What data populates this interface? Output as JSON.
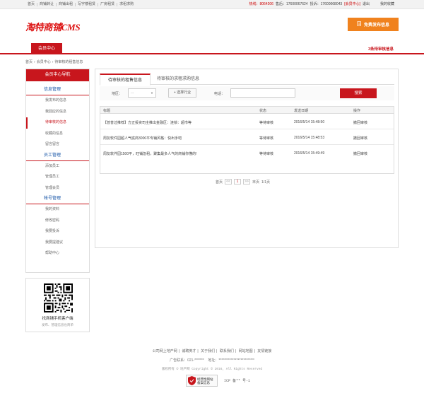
{
  "topbar": {
    "links": [
      "首页",
      "商铺转让",
      "商铺出租",
      "写字楼租赁",
      "厂房租赁",
      "求租求购"
    ],
    "hotline_label": "热线：",
    "hotline": "8064206",
    "phone_label": "售后：",
    "phone": "17600067624",
    "complaint_label": "投诉：",
    "complaint": "17600068043",
    "member_center": "[会员中心]",
    "logout": "退出",
    "my_favorites": "我的收藏"
  },
  "header": {
    "logo": "淘特商铺CMS",
    "publish_button": "免费发布信息"
  },
  "nav": {
    "tab": "会员中心",
    "right_notice": "3条待审核信息"
  },
  "breadcrumb": [
    "首页",
    "会员中心",
    "待审核的租售信息"
  ],
  "sidebar": {
    "title": "会员中心导航",
    "groups": [
      {
        "title": "信息管理",
        "items": [
          "我发布的信息",
          "我回应的信息",
          "待审核的信息",
          "收藏的信息",
          "留言留言"
        ]
      },
      {
        "title": "员工管理",
        "items": [
          "添加员工",
          "管理员工",
          "管理会员"
        ]
      },
      {
        "title": "帐号管理",
        "items": [
          "我的资料",
          "修改密码",
          "我要投诉",
          "我要提建议",
          "帮助中心"
        ]
      }
    ],
    "active_item": "待审核的信息"
  },
  "qr": {
    "title": "找商铺手机客户端",
    "subtitle": "发布、管理信息也简单"
  },
  "main": {
    "tabs": [
      "待审核的租售信息",
      "待审核的求租求购信息"
    ],
    "filter": {
      "area_label": "地区：",
      "area_value": "...",
      "industry_button": "+ 选择行业",
      "phone_label": "电话：",
      "phone_value": "",
      "search_button": "搜索"
    },
    "table": {
      "headers": [
        "标题",
        "状态",
        "发送日期",
        "操作"
      ],
      "rows": [
        {
          "title": "【普普过推荐】方正投资司主推出金融区：连锁：超市等",
          "status": "等待审核",
          "date": "2016/5/14 15:48:50",
          "action": "撤回审核"
        },
        {
          "title": "周友软件园超人气底商3000平专铺风格：快出手吧",
          "status": "等待审核",
          "date": "2016/5/14 15:48:53",
          "action": "撤回审核"
        },
        {
          "title": "周友软件园1500平，旺铺急租，聚集最多人气的商铺你懂的!",
          "status": "等待审核",
          "date": "2016/5/14 15:49:49",
          "action": "撤回审核"
        }
      ]
    },
    "pager": {
      "first": "首页",
      "prev": "<<",
      "current": "1",
      "next": ">>",
      "last": "末页",
      "count": "1/1页"
    }
  },
  "footer": {
    "links": [
      "公司网上地产网",
      "诚聘英才",
      "关于我们",
      "联系我们",
      "网站地图",
      "友情链接"
    ],
    "contact_label": "广告联系：",
    "contact": "021-*******",
    "address_label": "地址：",
    "address": "**************************",
    "copyright": "版权所有 © 地产网 Copyright © 2016, All Rights Reserved",
    "badge_line1": "经营性网站",
    "badge_line2": "备案信息",
    "icp": "ICP 备** 号-1"
  },
  "colors": {
    "brand": "#c8161d",
    "publish": "#f0821e",
    "link": "#1a57a8"
  }
}
